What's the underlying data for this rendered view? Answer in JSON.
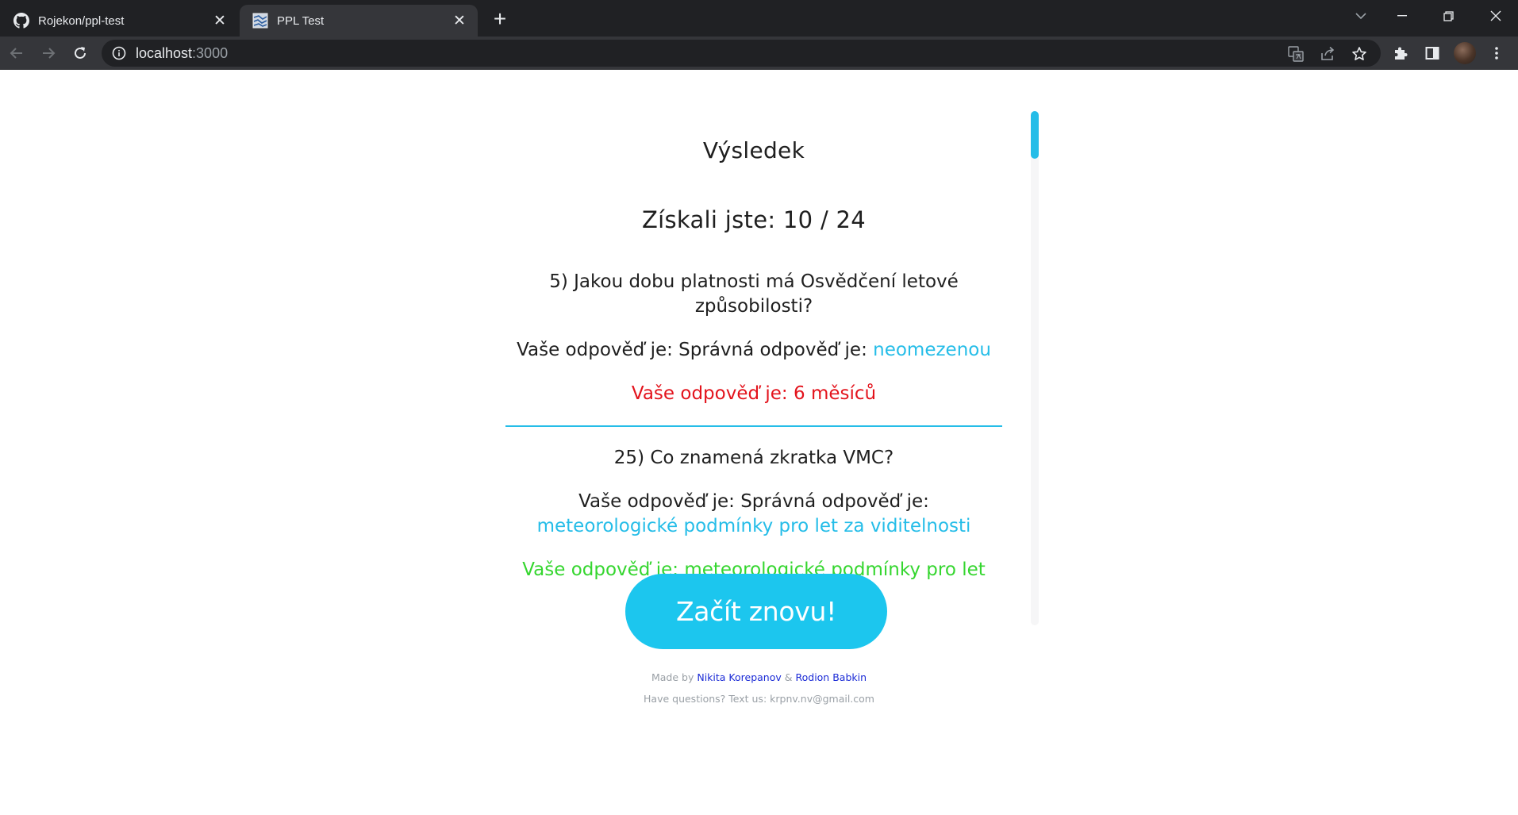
{
  "browser": {
    "tabs": [
      {
        "title": "Rojekon/ppl-test",
        "icon": "github-icon",
        "active": false
      },
      {
        "title": "PPL Test",
        "icon": "site-favicon",
        "active": true
      }
    ],
    "url_host": "localhost",
    "url_port": ":3000"
  },
  "result": {
    "title": "Výsledek",
    "score": "Získali jste: 10 / 24",
    "questions": [
      {
        "question": "5) Jakou dobu platnosti má Osvědčení letové způsobilosti?",
        "answer_prefix": "Vaše odpověď je: Správná odpověď je: ",
        "correct_answer": "neomezenou",
        "user_answer": "Vaše odpověď je: 6 měsíců",
        "is_correct": false
      },
      {
        "question": "25) Co znamená zkratka VMC?",
        "answer_prefix": "Vaše odpověď je: Správná odpověď je: ",
        "correct_answer": "meteorologické podmínky pro let za viditelnosti",
        "user_answer": "Vaše odpověď je: meteorologické podmínky pro let za viditelnosti",
        "is_correct": true
      }
    ],
    "restart_label": "Začít znovu!"
  },
  "footer": {
    "made_by": "Made by",
    "author1": "Nikita Korepanov",
    "amp": "&",
    "author2": "Rodion Babkin",
    "contact": "Have questions? Text us: krpnv.nv@gmail.com"
  },
  "colors": {
    "accent": "#1cc6ee",
    "correct_text": "#35d62f",
    "wrong_text": "#e3131c",
    "link": "#1b2bd6"
  }
}
